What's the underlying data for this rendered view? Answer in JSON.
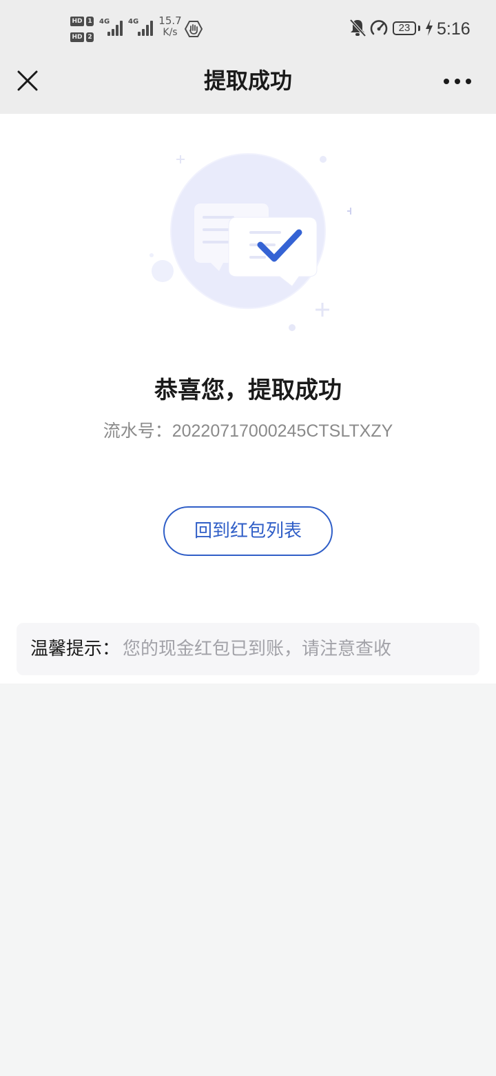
{
  "status_bar": {
    "sim1_badge": "HD",
    "sim1_number": "1",
    "sim2_badge": "HD",
    "sim2_number": "2",
    "network_type_1": "4G",
    "network_type_2": "4G",
    "speed_value": "15.7",
    "speed_unit": "K/s",
    "battery_level": "23",
    "time": "5:16",
    "icons": [
      "hd-icon",
      "signal-icon",
      "signal-icon",
      "shield-icon",
      "mute-bell-icon",
      "speedometer-icon",
      "battery-icon",
      "charging-bolt-icon"
    ]
  },
  "nav": {
    "title": "提取成功",
    "left_icon": "close-icon",
    "right_icon": "more-icon"
  },
  "result": {
    "illustration_icon": "success-check-message-icon",
    "title": "恭喜您，提取成功",
    "serial_label": "流水号：",
    "serial_number": "20220717000245CTSLTXZY",
    "back_button_label": "回到红包列表"
  },
  "tip": {
    "label": "温馨提示：",
    "text": "您的现金红包已到账，请注意查收"
  },
  "colors": {
    "accent": "#2f5ec7",
    "header_bg": "#ededed",
    "page_bg": "#f4f5f5",
    "tip_bg": "#f6f6f8",
    "muted_text": "#8a8a8a"
  }
}
